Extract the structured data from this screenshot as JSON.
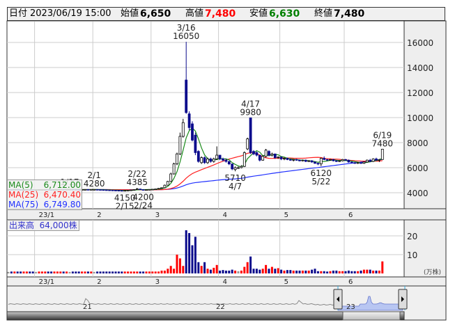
{
  "header": {
    "date_label": "日付",
    "datetime": "2023/06/19 15:00",
    "open_label": "始値",
    "open": "6,650",
    "high_label": "高値",
    "high": "7,480",
    "low_label": "安値",
    "low": "6,630",
    "close_label": "終値",
    "close": "7,480"
  },
  "legend": {
    "ma5_label": "MA(5)",
    "ma5_value": "6,712.00",
    "ma25_label": "MA(25)",
    "ma25_value": "6,470.40",
    "ma75_label": "MA(75)",
    "ma75_value": "6,749.80"
  },
  "volume_legend": {
    "label": "出来高",
    "value": "64,000株"
  },
  "colors": {
    "up_volume": "#ff0000",
    "down": "#0a0a8c",
    "ma5": "#1a8a1a",
    "ma25": "#ff2020",
    "ma75": "#2030ff",
    "high": "#ff0000",
    "low": "#008000"
  },
  "chart_data": {
    "type": "candlestick",
    "price_axis": {
      "ticks": [
        "4000",
        "6000",
        "8000",
        "10000",
        "12000",
        "14000",
        "16000"
      ],
      "range": [
        3000,
        17500
      ]
    },
    "volume_axis": {
      "ticks": [
        "10",
        "20"
      ],
      "unit": "(万株)"
    },
    "month_ticks": [
      {
        "label": "23/1",
        "index": 9
      },
      {
        "label": "2",
        "index": 28
      },
      {
        "label": "3",
        "index": 47
      },
      {
        "label": "4",
        "index": 69
      },
      {
        "label": "5",
        "index": 89
      },
      {
        "label": "6",
        "index": 110
      }
    ],
    "navigator_labels": [
      "21",
      "22",
      "23"
    ],
    "annotations": [
      {
        "index": 20,
        "date": "1/17",
        "pos": "above"
      },
      {
        "index": 28,
        "date": "2/1",
        "value": "4280",
        "pos": "above"
      },
      {
        "index": 38,
        "date": "2/15",
        "value": "4150",
        "pos": "below"
      },
      {
        "index": 42,
        "date": "2/22",
        "value": "4385",
        "pos": "above"
      },
      {
        "index": 44,
        "date": "2/24",
        "value": "4200",
        "pos": "below"
      },
      {
        "index": 58,
        "date": "3/16",
        "value": "16050",
        "pos": "above"
      },
      {
        "index": 74,
        "date": "4/7",
        "value": "5710",
        "pos": "below"
      },
      {
        "index": 79,
        "date": "4/17",
        "value": "9980",
        "pos": "above"
      },
      {
        "index": 102,
        "date": "5/22",
        "value": "6120",
        "pos": "below"
      },
      {
        "index": 122,
        "date": "6/19",
        "value": "7480",
        "pos": "above"
      }
    ],
    "candles_fields": [
      "open",
      "high",
      "low",
      "close",
      "volume_10k"
    ],
    "candles": [
      [
        4250,
        4260,
        4240,
        4250,
        0.8
      ],
      [
        4250,
        4260,
        4230,
        4240,
        1.0
      ],
      [
        4240,
        4270,
        4240,
        4260,
        1.0
      ],
      [
        4260,
        4260,
        4240,
        4250,
        1.0
      ],
      [
        4250,
        4250,
        4220,
        4230,
        1.0
      ],
      [
        4230,
        4250,
        4230,
        4240,
        1.0
      ],
      [
        4240,
        4260,
        4240,
        4250,
        1.0
      ],
      [
        4250,
        4250,
        4230,
        4240,
        1.0
      ],
      [
        4240,
        4240,
        4220,
        4230,
        1.0
      ],
      [
        4230,
        4230,
        4220,
        4230,
        0.8
      ],
      [
        4230,
        4250,
        4230,
        4240,
        1.0
      ],
      [
        4240,
        4260,
        4240,
        4250,
        1.0
      ],
      [
        4250,
        4270,
        4250,
        4260,
        1.0
      ],
      [
        4260,
        4260,
        4230,
        4240,
        1.0
      ],
      [
        4240,
        4240,
        4220,
        4230,
        1.0
      ],
      [
        4230,
        4260,
        4230,
        4250,
        1.0
      ],
      [
        4250,
        4270,
        4250,
        4260,
        1.0
      ],
      [
        4260,
        4280,
        4260,
        4270,
        1.0
      ],
      [
        4270,
        4270,
        4250,
        4260,
        1.0
      ],
      [
        4260,
        4280,
        4260,
        4270,
        1.0
      ],
      [
        4270,
        4290,
        4260,
        4270,
        0.8
      ],
      [
        4270,
        4270,
        4250,
        4260,
        1.0
      ],
      [
        4260,
        4260,
        4240,
        4250,
        1.0
      ],
      [
        4250,
        4250,
        4230,
        4240,
        1.0
      ],
      [
        4240,
        4260,
        4240,
        4250,
        1.0
      ],
      [
        4250,
        4270,
        4250,
        4260,
        1.0
      ],
      [
        4260,
        4260,
        4240,
        4250,
        1.0
      ],
      [
        4250,
        4270,
        4250,
        4260,
        1.0
      ],
      [
        4260,
        4280,
        4250,
        4260,
        0.8
      ],
      [
        4260,
        4260,
        4240,
        4250,
        1.0
      ],
      [
        4250,
        4250,
        4230,
        4240,
        1.0
      ],
      [
        4240,
        4240,
        4220,
        4230,
        1.0
      ],
      [
        4230,
        4230,
        4210,
        4220,
        1.0
      ],
      [
        4220,
        4220,
        4200,
        4210,
        1.0
      ],
      [
        4210,
        4210,
        4190,
        4200,
        1.0
      ],
      [
        4200,
        4200,
        4180,
        4190,
        1.0
      ],
      [
        4190,
        4190,
        4170,
        4180,
        1.0
      ],
      [
        4180,
        4180,
        4160,
        4170,
        1.0
      ],
      [
        4170,
        4190,
        4150,
        4180,
        1.0
      ],
      [
        4180,
        4210,
        4180,
        4200,
        1.0
      ],
      [
        4200,
        4230,
        4200,
        4220,
        1.0
      ],
      [
        4220,
        4260,
        4220,
        4250,
        1.0
      ],
      [
        4250,
        4385,
        4240,
        4300,
        1.0
      ],
      [
        4300,
        4300,
        4240,
        4250,
        1.0
      ],
      [
        4250,
        4260,
        4200,
        4230,
        1.0
      ],
      [
        4230,
        4250,
        4230,
        4240,
        1.0
      ],
      [
        4240,
        4270,
        4240,
        4260,
        1.0
      ],
      [
        4260,
        4290,
        4250,
        4280,
        1.0
      ],
      [
        4280,
        4310,
        4270,
        4300,
        1.0
      ],
      [
        4300,
        4360,
        4290,
        4350,
        1.0
      ],
      [
        4350,
        4420,
        4340,
        4400,
        1.5
      ],
      [
        4400,
        4650,
        4390,
        4600,
        1.5
      ],
      [
        4600,
        4950,
        4580,
        4900,
        2.5
      ],
      [
        4900,
        5600,
        4850,
        5500,
        4.0
      ],
      [
        5500,
        6400,
        5450,
        6300,
        2.5
      ],
      [
        6300,
        7200,
        6200,
        7100,
        10.0
      ],
      [
        7100,
        8800,
        7000,
        8500,
        8.0
      ],
      [
        8500,
        9900,
        8400,
        9600,
        4.0
      ],
      [
        13000,
        16050,
        10300,
        10400,
        23.0
      ],
      [
        10300,
        10500,
        9000,
        9200,
        21.5
      ],
      [
        9500,
        9700,
        8100,
        8200,
        15.0
      ],
      [
        8600,
        8800,
        7000,
        7200,
        19.5
      ],
      [
        7300,
        7400,
        6400,
        6500,
        6.0
      ],
      [
        6400,
        6900,
        6300,
        6800,
        4.0
      ],
      [
        6800,
        6900,
        6300,
        6400,
        6.0
      ],
      [
        6400,
        6800,
        6300,
        6700,
        2.5
      ],
      [
        6700,
        6800,
        6400,
        6500,
        2.0
      ],
      [
        6500,
        6800,
        6400,
        6700,
        3.0
      ],
      [
        6700,
        7700,
        6600,
        7000,
        4.5
      ],
      [
        7000,
        7000,
        6600,
        6700,
        1.5
      ],
      [
        6700,
        6800,
        6500,
        6600,
        1.8
      ],
      [
        6600,
        6700,
        6400,
        6500,
        1.5
      ],
      [
        6500,
        6500,
        6200,
        6300,
        1.5
      ],
      [
        6300,
        6300,
        5800,
        5900,
        2.0
      ],
      [
        5850,
        6100,
        5710,
        6000,
        1.5
      ],
      [
        6000,
        6100,
        5900,
        6000,
        1.2
      ],
      [
        6000,
        6200,
        5950,
        6100,
        1.5
      ],
      [
        6100,
        7300,
        6050,
        7200,
        3.5
      ],
      [
        7500,
        8400,
        7400,
        8300,
        6.0
      ],
      [
        9980,
        9980,
        7100,
        7200,
        9.0
      ],
      [
        7300,
        7400,
        7000,
        7100,
        2.5
      ],
      [
        7200,
        7300,
        6900,
        7000,
        2.5
      ],
      [
        7000,
        7000,
        6500,
        6600,
        2.0
      ],
      [
        6600,
        7000,
        6550,
        6900,
        2.5
      ],
      [
        6900,
        7500,
        6800,
        7400,
        4.5
      ],
      [
        7300,
        7400,
        6900,
        7000,
        2.5
      ],
      [
        7000,
        7200,
        6900,
        7100,
        3.5
      ],
      [
        7100,
        7100,
        6700,
        6800,
        2.5
      ],
      [
        6800,
        6900,
        6700,
        6850,
        2.8
      ],
      [
        6850,
        6900,
        6600,
        6700,
        2.0
      ],
      [
        6700,
        6800,
        6600,
        6750,
        1.5
      ],
      [
        6750,
        6800,
        6600,
        6650,
        1.8
      ],
      [
        6650,
        6700,
        6550,
        6600,
        1.8
      ],
      [
        6600,
        6700,
        6500,
        6650,
        1.5
      ],
      [
        6650,
        6700,
        6550,
        6600,
        1.5
      ],
      [
        6600,
        6650,
        6500,
        6550,
        1.5
      ],
      [
        6550,
        6650,
        6500,
        6600,
        1.5
      ],
      [
        6600,
        6650,
        6450,
        6500,
        1.5
      ],
      [
        6500,
        6600,
        6450,
        6550,
        1.5
      ],
      [
        6550,
        6600,
        6400,
        6450,
        2.0
      ],
      [
        6450,
        6500,
        6300,
        6350,
        2.5
      ],
      [
        6350,
        6400,
        6200,
        6300,
        1.2
      ],
      [
        6300,
        6800,
        6120,
        6750,
        1.2
      ],
      [
        6750,
        6900,
        6600,
        6650,
        1.2
      ],
      [
        6650,
        6700,
        6550,
        6600,
        1.0
      ],
      [
        6600,
        6700,
        6550,
        6650,
        1.2
      ],
      [
        6650,
        6700,
        6500,
        6550,
        1.5
      ],
      [
        6550,
        6600,
        6450,
        6500,
        1.5
      ],
      [
        6500,
        6600,
        6450,
        6550,
        1.2
      ],
      [
        6550,
        6700,
        6500,
        6650,
        1.2
      ],
      [
        6650,
        6700,
        6550,
        6600,
        1.2
      ],
      [
        6600,
        6650,
        6400,
        6450,
        1.5
      ],
      [
        6450,
        6500,
        6350,
        6400,
        1.2
      ],
      [
        6400,
        6450,
        6300,
        6350,
        1.2
      ],
      [
        6350,
        6450,
        6300,
        6400,
        1.2
      ],
      [
        6400,
        6450,
        6300,
        6350,
        1.5
      ],
      [
        6350,
        6500,
        6300,
        6450,
        2.0
      ],
      [
        6450,
        6650,
        6400,
        6600,
        2.0
      ],
      [
        6600,
        6700,
        6450,
        6500,
        2.0
      ],
      [
        6500,
        6750,
        6450,
        6700,
        1.5
      ],
      [
        6700,
        6800,
        6550,
        6600,
        1.5
      ],
      [
        6600,
        6700,
        6450,
        6650,
        1.5
      ],
      [
        6650,
        7480,
        6630,
        7480,
        6.4
      ]
    ]
  }
}
